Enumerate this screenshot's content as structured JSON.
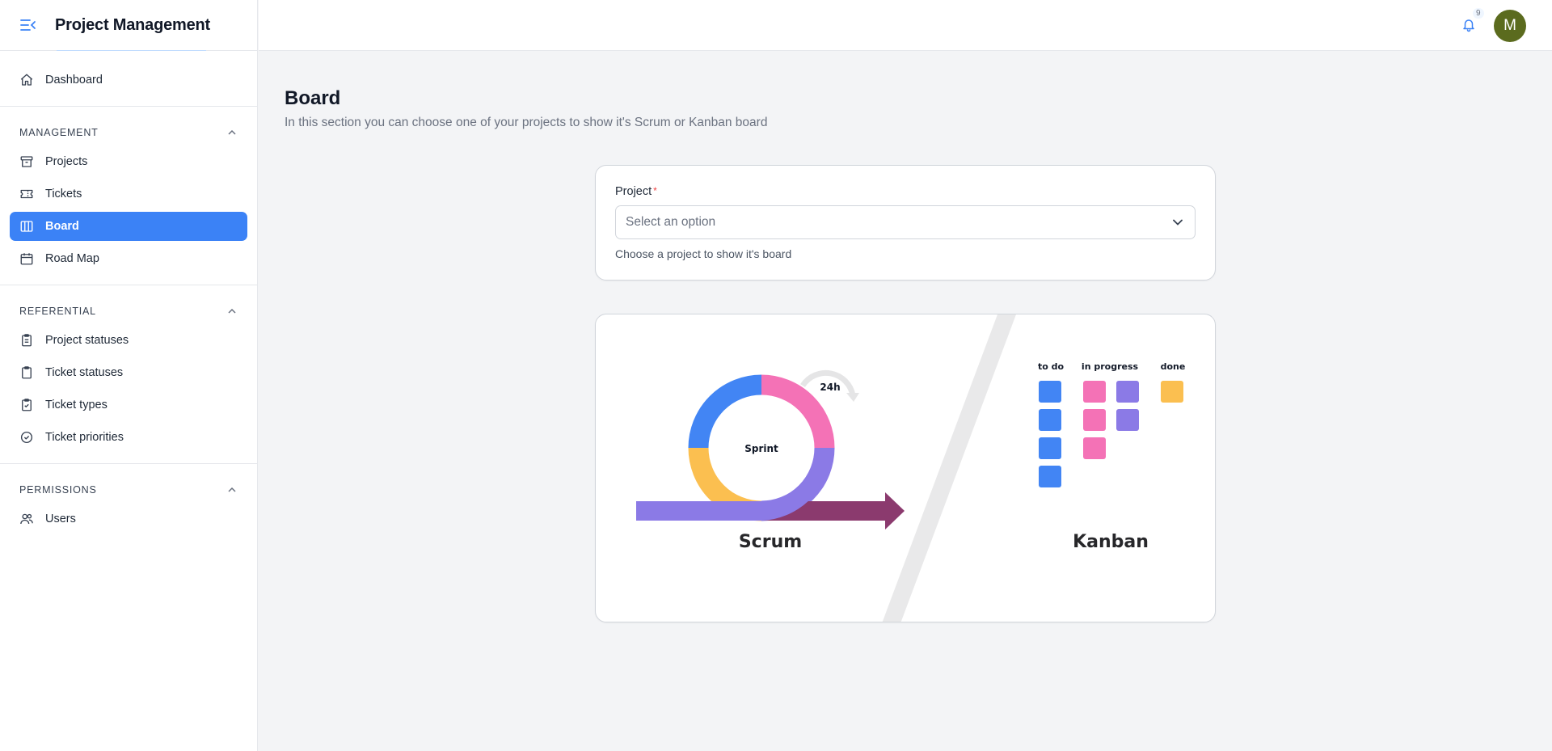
{
  "app": {
    "title": "Project Management"
  },
  "sidebar": {
    "top_items": [
      {
        "label": "Dashboard",
        "icon": "home-icon"
      }
    ],
    "groups": [
      {
        "title": "MANAGEMENT",
        "items": [
          {
            "label": "Projects",
            "icon": "archive-icon"
          },
          {
            "label": "Tickets",
            "icon": "ticket-icon"
          },
          {
            "label": "Board",
            "icon": "columns-icon",
            "active": true
          },
          {
            "label": "Road Map",
            "icon": "calendar-icon"
          }
        ]
      },
      {
        "title": "REFERENTIAL",
        "items": [
          {
            "label": "Project statuses",
            "icon": "clipboard-list-icon"
          },
          {
            "label": "Ticket statuses",
            "icon": "clipboard-icon"
          },
          {
            "label": "Ticket types",
            "icon": "clipboard-check-icon"
          },
          {
            "label": "Ticket priorities",
            "icon": "badge-check-icon"
          }
        ]
      },
      {
        "title": "PERMISSIONS",
        "items": [
          {
            "label": "Users",
            "icon": "users-icon"
          }
        ]
      }
    ]
  },
  "topbar": {
    "notification_count": "9",
    "avatar_initial": "M"
  },
  "page": {
    "title": "Board",
    "subtitle": "In this section you can choose one of your projects to show it's Scrum or Kanban board"
  },
  "form": {
    "project_label": "Project",
    "required_mark": "*",
    "select_placeholder": "Select an option",
    "helper": "Choose a project to show it's board"
  },
  "illustration": {
    "sprint_label": "Sprint",
    "cycle_label": "24h",
    "scrum_label": "Scrum",
    "kanban_label": "Kanban",
    "columns": [
      "to do",
      "in progress",
      "done"
    ]
  },
  "colors": {
    "accent": "#3b82f6",
    "blue": "#4285f4",
    "pink": "#f472b6",
    "purple": "#8b7ae6",
    "yellow": "#fbbf50",
    "plum": "#8b3a6e",
    "avatar": "#5b6b1e"
  }
}
